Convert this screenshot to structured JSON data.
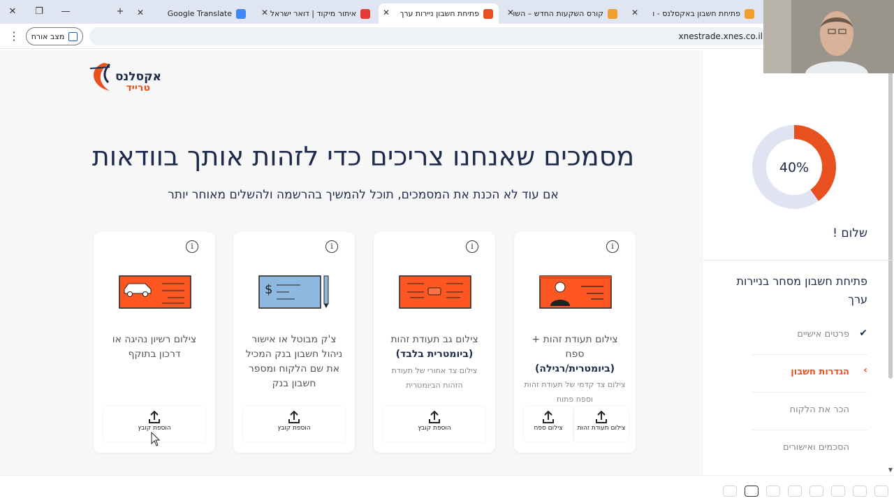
{
  "browser": {
    "tabs": [
      {
        "label": "Google Translate",
        "favicon_color": "#4285f4"
      },
      {
        "label": "איתור מיקוד | דואר ישראל",
        "favicon_color": "#e53935"
      },
      {
        "label": "פתיחת חשבון ניירות ערך",
        "favicon_color": "#e8501f"
      },
      {
        "label": "קורס השקעות החדש – השו",
        "favicon_color": "#f0a030"
      },
      {
        "label": "פתיחת חשבון באקסלנס - ו",
        "favicon_color": "#f0a030"
      }
    ],
    "guest_label": "מצב אורח",
    "url": "xnestrade.xnes.co.il"
  },
  "logo": {
    "brand": "אקסלנס",
    "sub": "טרייד"
  },
  "main": {
    "title": "מסמכים שאנחנו צריכים כדי לזהות אותך בוודאות",
    "subtitle": "אם עוד לא הכנת את המסמכים, תוכל להמשיך בהרשמה ולהשלים מאוחר יותר"
  },
  "cards": [
    {
      "title_line1": "צילום תעודת זהות +",
      "title_line2": "ספח",
      "title_bold": "(ביומטרית/רגילה)",
      "desc": "צילום צד קדמי של תעודת זהות וספח פתוח",
      "upload1": "צילום תעודת זהות",
      "upload2": "צילום ספח"
    },
    {
      "title_line1": "צילום גב תעודת זהות",
      "title_bold": "(ביומטרית בלבד)",
      "desc": "צילום צד אחורי של תעודת הזהות הביומטרית",
      "upload1": "הוספת קובץ"
    },
    {
      "title_line1": "צ'ק מבוטל או אישור ניהול חשבון בנק המכיל את שם הלקוח ומספר חשבון בנק",
      "upload1": "הוספת קובץ"
    },
    {
      "title_line1": "צילום רשיון נהיגה או דרכון בתוקף",
      "upload1": "הוספת קובץ"
    }
  ],
  "sidebar": {
    "progress_percent": 40,
    "progress_label": "40%",
    "greeting": "שלום !",
    "section_title": "פתיחת חשבון מסחר בניירות ערך",
    "steps": [
      {
        "label": "פרטים אישיים",
        "state": "done"
      },
      {
        "label": "הגדרות חשבון",
        "state": "active"
      },
      {
        "label": "הכר את הלקוח",
        "state": "pending"
      },
      {
        "label": "הסכמים ואישורים",
        "state": "pending"
      }
    ]
  },
  "colors": {
    "accent": "#e8501f",
    "navy": "#1d2a4a",
    "donut_track": "#dfe3f2"
  }
}
